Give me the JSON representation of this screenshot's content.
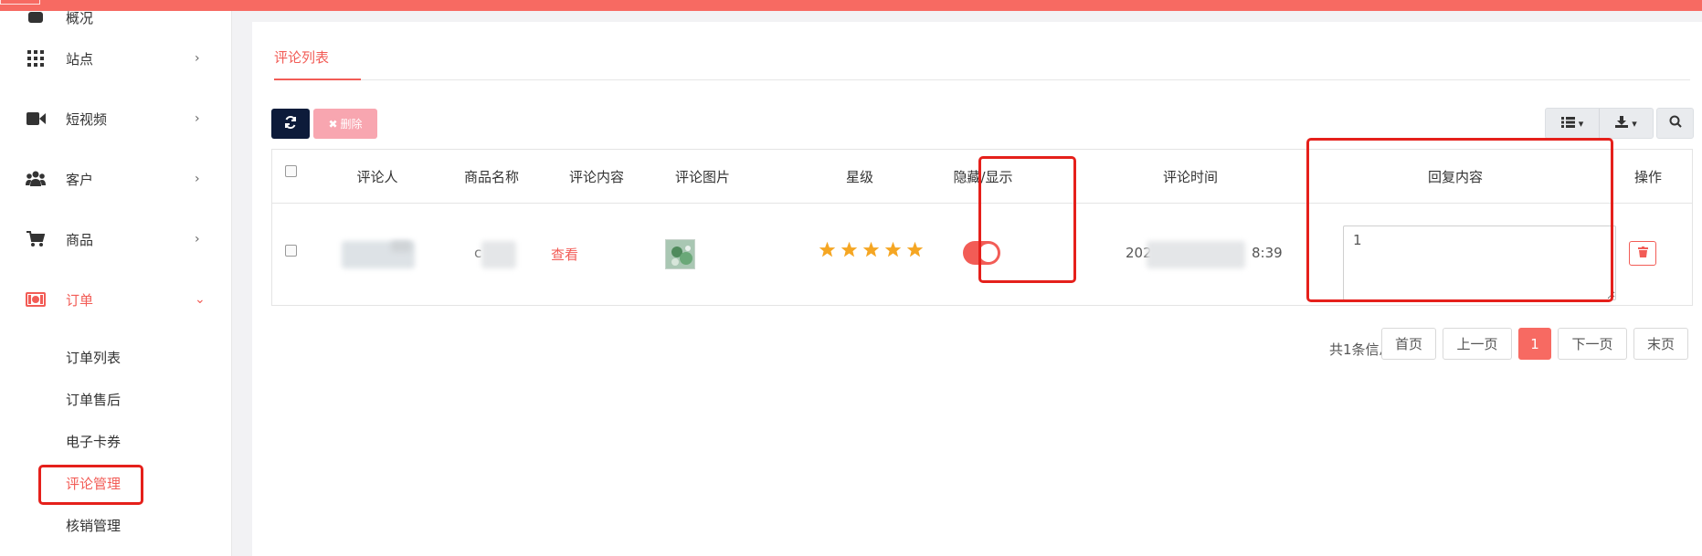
{
  "colors": {
    "accent": "#f25c56",
    "topbar": "#f76a62",
    "highlight": "#e5201b",
    "dark_button": "#0d1b3a",
    "delete_button": "#f8a6b0",
    "star": "#f5a623"
  },
  "sidebar": {
    "top_partial_label": "概况",
    "items": [
      {
        "label": "站点",
        "icon": "grid-icon",
        "expanded": false
      },
      {
        "label": "短视频",
        "icon": "video-camera-icon",
        "expanded": false
      },
      {
        "label": "客户",
        "icon": "users-icon",
        "expanded": false
      },
      {
        "label": "商品",
        "icon": "shopping-cart-icon",
        "expanded": false
      },
      {
        "label": "订单",
        "icon": "money-icon",
        "expanded": true
      }
    ],
    "subitems": [
      {
        "label": "订单列表",
        "active": false
      },
      {
        "label": "订单售后",
        "active": false
      },
      {
        "label": "电子卡券",
        "active": false
      },
      {
        "label": "评论管理",
        "active": true
      },
      {
        "label": "核销管理",
        "active": false
      }
    ]
  },
  "main": {
    "tab_label": "评论列表",
    "toolbar": {
      "refresh_icon": "refresh-icon",
      "delete_label": "删除",
      "columns_icon": "list-icon",
      "export_icon": "download-icon",
      "search_icon": "search-icon"
    },
    "table": {
      "headers": [
        "评论人",
        "商品名称",
        "评论内容",
        "评论图片",
        "星级",
        "隐藏/显示",
        "评论时间",
        "回复内容",
        "操作"
      ],
      "rows": [
        {
          "reviewer": "",
          "product_name_visible": "c",
          "content_link": "查看",
          "stars": 5,
          "visible": true,
          "time_prefix": "202",
          "time_suffix": "8:39",
          "reply": "1"
        }
      ]
    },
    "pagination": {
      "info": "共1条信息",
      "first": "首页",
      "prev": "上一页",
      "current": "1",
      "next": "下一页",
      "last": "末页"
    }
  }
}
